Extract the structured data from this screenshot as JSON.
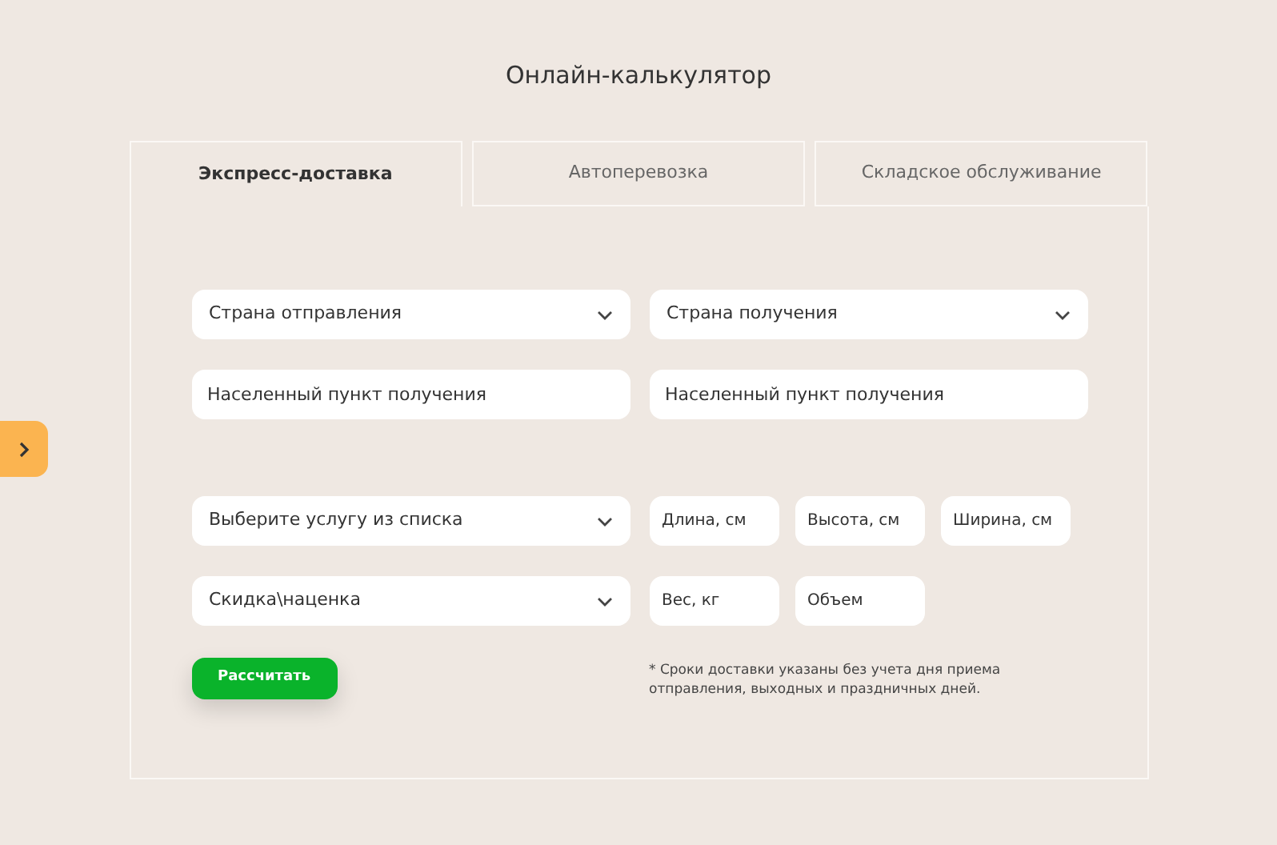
{
  "title": "Онлайн-калькулятор",
  "tabs": [
    {
      "label": "Экспресс-доставка",
      "selected": true
    },
    {
      "label": "Автоперевозка",
      "selected": false
    },
    {
      "label": "Складское обслуживание",
      "selected": false
    }
  ],
  "sections": [
    {
      "rows": [
        [
          {
            "kind": "select",
            "placeholder": "Страна отправления"
          },
          {
            "kind": "select",
            "placeholder": "Страна получения"
          }
        ],
        [
          {
            "kind": "input",
            "placeholder": "Населенный пункт получения"
          },
          {
            "kind": "input",
            "placeholder": "Населенный пункт получения"
          }
        ]
      ]
    },
    {
      "rows": [
        [
          {
            "kind": "select",
            "placeholder": "Выберите услугу из списка"
          },
          {
            "kind": "small_input",
            "placeholder": "Длина, см"
          },
          {
            "kind": "small_input",
            "placeholder": "Высота, см"
          },
          {
            "kind": "small_input",
            "placeholder": "Ширина, см"
          }
        ],
        [
          {
            "kind": "select",
            "placeholder": "Скидка\\наценка"
          },
          {
            "kind": "small_input",
            "placeholder": "Вес, кг"
          },
          {
            "kind": "small_input",
            "placeholder": "Объем"
          }
        ]
      ]
    }
  ],
  "button": "Рассчитать",
  "note": "*  Сроки доставки указаны без учета дня приема отправления, выходных и праздничных дней."
}
